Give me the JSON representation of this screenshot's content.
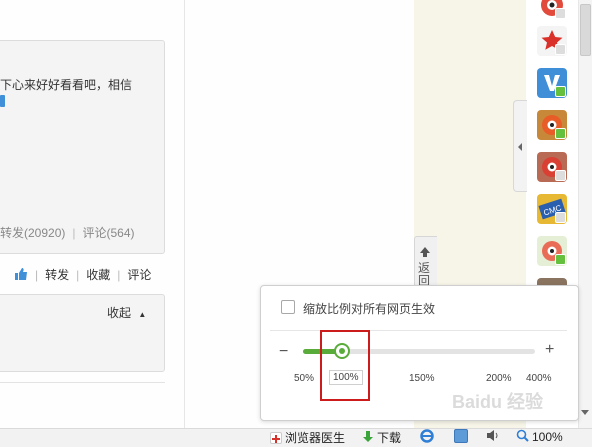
{
  "feed": {
    "post_text": "下心来好好看看吧，相信",
    "stats": {
      "repost": "转发(20920)",
      "comment": "评论(564)"
    },
    "actions": {
      "repost": "转发",
      "favorite": "收藏",
      "comment": "评论"
    },
    "collapse_label": "收起"
  },
  "back_button": {
    "label": "返回"
  },
  "sidebar_icons": [
    "weibo-eye-icon",
    "star-icon",
    "v-icon",
    "eye-icon",
    "eye-icon",
    "cmc-icon",
    "eye-icon",
    "app-icon"
  ],
  "zoom_popup": {
    "checkbox_label": "缩放比例对所有网页生效",
    "checked": false,
    "minus": "−",
    "plus": "+",
    "ticks": [
      "50%",
      "100%",
      "150%",
      "200%",
      "400%"
    ],
    "current": "100%",
    "accent_color": "#5aac3a",
    "highlight_color": "#cc1b1b"
  },
  "statusbar": {
    "doctor_label": "浏览器医生",
    "download_label": "下载",
    "zoom_label": "100%"
  },
  "watermark": "Baidu 经验"
}
